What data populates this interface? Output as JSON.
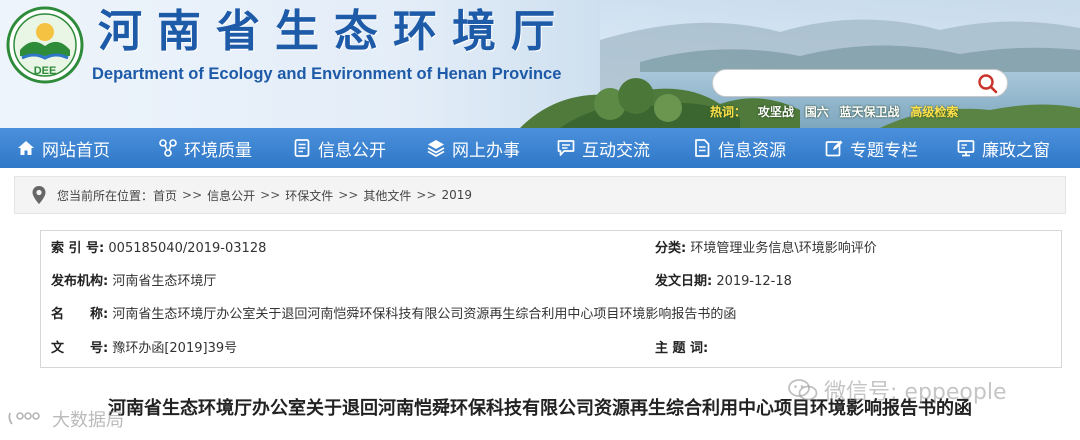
{
  "header": {
    "logo_text": "DEE",
    "title": "河南省生态环境厅",
    "subtitle": "Department of Ecology and Environment of Henan Province",
    "search": {
      "placeholder": "",
      "value": ""
    },
    "hot_label": "热词：",
    "hot_items": [
      "攻坚战",
      "国六",
      "蓝天保卫战"
    ],
    "advanced_search": "高级检索"
  },
  "nav": {
    "items": [
      {
        "label": "网站首页",
        "icon": "home-icon"
      },
      {
        "label": "环境质量",
        "icon": "network-icon"
      },
      {
        "label": "信息公开",
        "icon": "document-icon"
      },
      {
        "label": "网上办事",
        "icon": "layers-icon"
      },
      {
        "label": "互动交流",
        "icon": "chat-icon"
      },
      {
        "label": "信息资源",
        "icon": "file-icon"
      },
      {
        "label": "专题专栏",
        "icon": "edit-icon"
      },
      {
        "label": "廉政之窗",
        "icon": "monitor-icon"
      }
    ]
  },
  "breadcrumb": {
    "prefix": "您当前所在位置：",
    "items": [
      "首页",
      "信息公开",
      "环保文件",
      "其他文件",
      "2019"
    ],
    "separator": ">>"
  },
  "info": {
    "index_label": "索 引 号:",
    "index_value": "005185040/2019-03128",
    "category_label": "分类:",
    "category_value": "环境管理业务信息\\环境影响评价",
    "issuer_label": "发布机构:",
    "issuer_value": "河南省生态环境厅",
    "date_label": "发文日期:",
    "date_value": "2019-12-18",
    "name_label": "名　　称:",
    "name_value": "河南省生态环境厅办公室关于退回河南恺舜环保科技有限公司资源再生综合利用中心项目环境影响报告书的函",
    "docno_label": "文　　号:",
    "docno_value": "豫环办函[2019]39号",
    "subject_label": "主 题 词:",
    "subject_value": ""
  },
  "article": {
    "title": "河南省生态环境厅办公室关于退回河南恺舜环保科技有限公司资源再生综合利用中心项目环境影响报告书的函"
  },
  "watermarks": {
    "wechat": "微信号: eppeople",
    "bigdata": "大数据局"
  },
  "colors": {
    "brand_blue": "#1d5aa8",
    "nav_blue": "#3a82d2",
    "hot_yellow": "#ffe14a"
  }
}
